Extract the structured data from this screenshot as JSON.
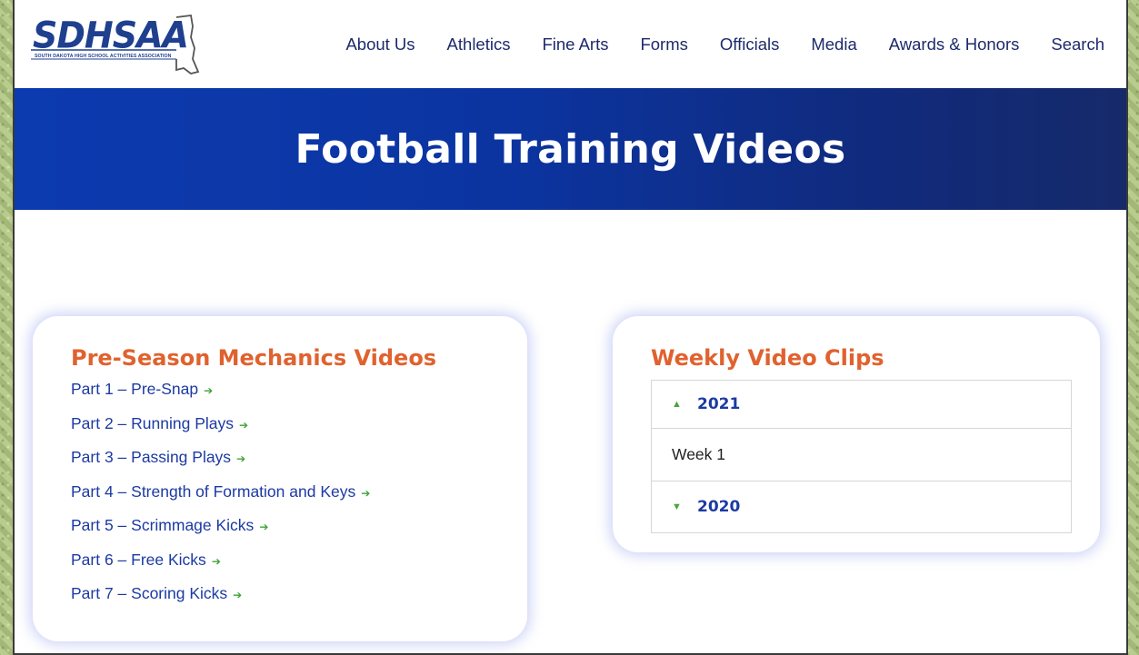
{
  "logo": {
    "text": "SDHSAA",
    "subtitle": "SOUTH DAKOTA HIGH SCHOOL ACTIVITIES ASSOCIATION"
  },
  "nav": {
    "items": [
      "About Us",
      "Athletics",
      "Fine Arts",
      "Forms",
      "Officials",
      "Media",
      "Awards & Honors",
      "Search"
    ]
  },
  "banner": {
    "title": "Football Training Videos"
  },
  "preseason": {
    "title": "Pre-Season Mechanics Videos",
    "arrow_icon": "arrow-right-icon",
    "links": [
      "Part 1 – Pre-Snap",
      "Part 2 – Running Plays",
      "Part 3 – Passing Plays",
      "Part 4 – Strength of Formation and Keys",
      "Part 5 – Scrimmage Kicks",
      "Part 6 – Free Kicks",
      "Part 7 – Scoring Kicks"
    ]
  },
  "weekly": {
    "title": "Weekly Video Clips",
    "accordion": [
      {
        "year": "2021",
        "expanded": true,
        "items": [
          "Week 1"
        ]
      },
      {
        "year": "2020",
        "expanded": false,
        "items": []
      }
    ]
  },
  "colors": {
    "brand_blue": "#1c3aa3",
    "accent_orange": "#e0622e",
    "arrow_green": "#3fa23a",
    "banner_start": "#0c3bb0",
    "banner_end": "#162a6a"
  }
}
